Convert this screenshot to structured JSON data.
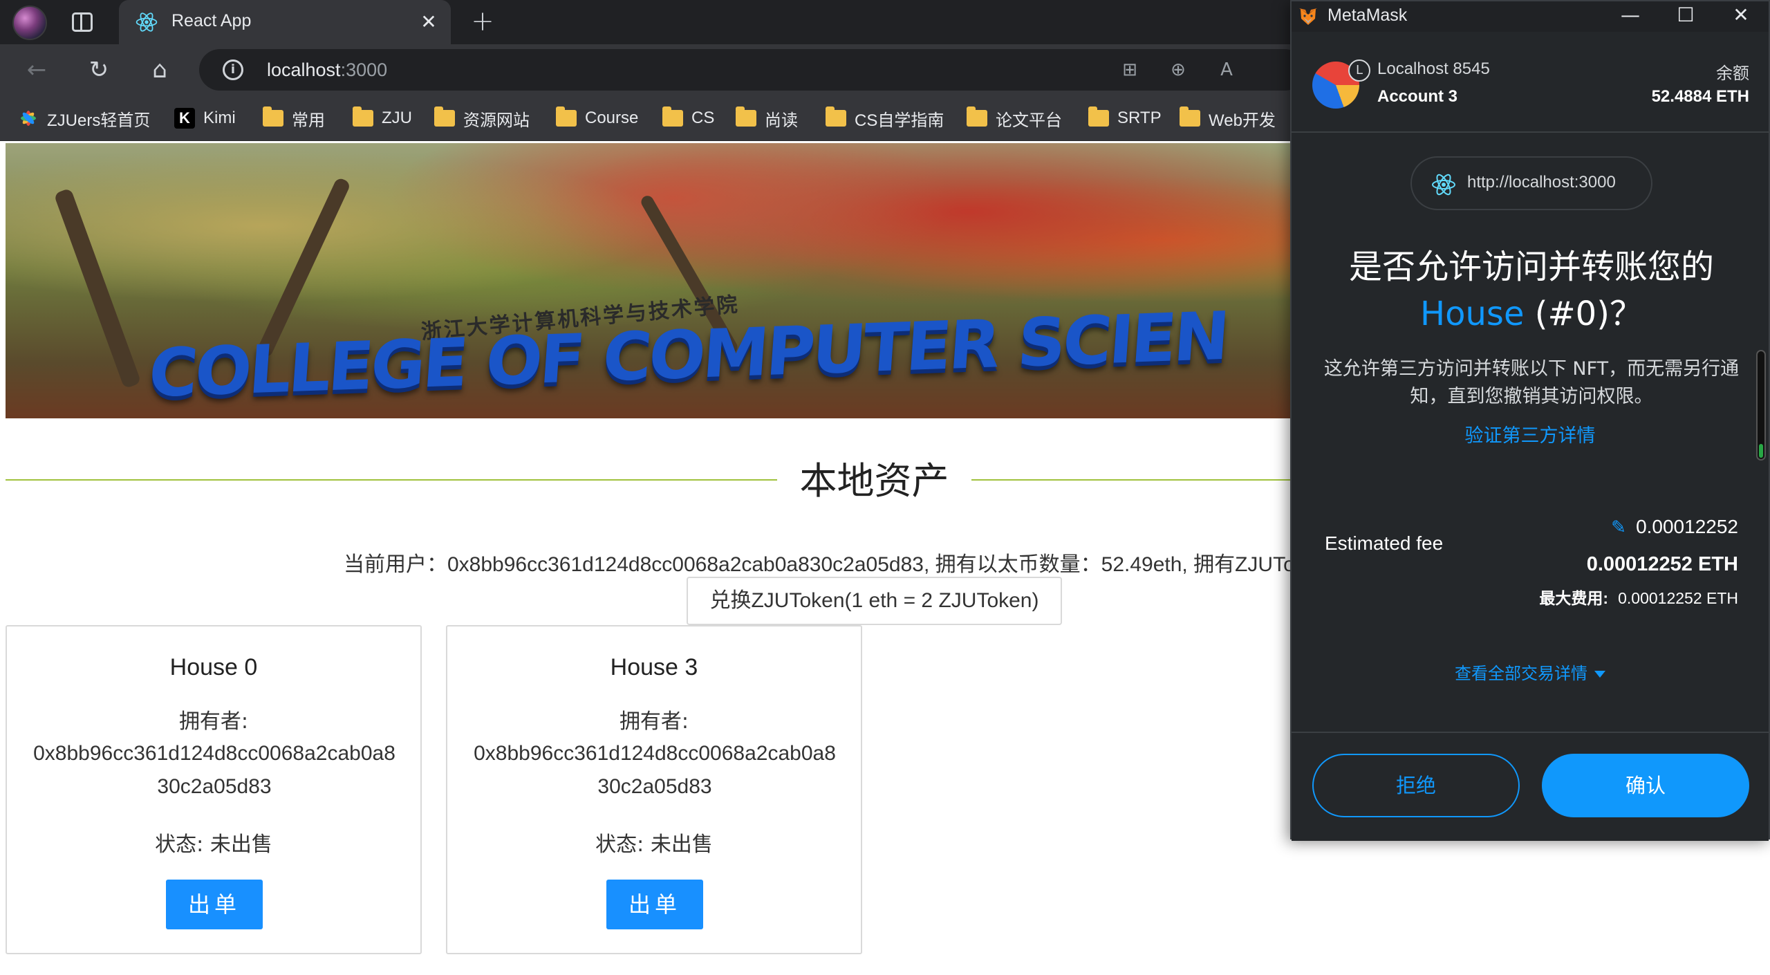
{
  "browser": {
    "tab_title": "React App",
    "url_host": "localhost",
    "url_port": ":3000",
    "bookmarks": [
      {
        "label": "ZJUers轻首页",
        "icon": "zju-flower-icon"
      },
      {
        "label": "Kimi",
        "icon": "kimi-icon"
      },
      {
        "label": "常用",
        "icon": "folder-icon"
      },
      {
        "label": "ZJU",
        "icon": "folder-icon"
      },
      {
        "label": "资源网站",
        "icon": "folder-icon"
      },
      {
        "label": "Course",
        "icon": "folder-icon"
      },
      {
        "label": "CS",
        "icon": "folder-icon"
      },
      {
        "label": "尚读",
        "icon": "folder-icon"
      },
      {
        "label": "CS自学指南",
        "icon": "folder-icon"
      },
      {
        "label": "论文平台",
        "icon": "folder-icon"
      },
      {
        "label": "SRTP",
        "icon": "folder-icon"
      },
      {
        "label": "Web开发",
        "icon": "folder-icon"
      }
    ]
  },
  "page": {
    "banner_subtitle": "浙江大学计算机科学与技术学院",
    "banner_title": "COLLEGE OF COMPUTER SCIEN",
    "section_title": "本地资产",
    "user_info": "当前用户：0x8bb96cc361d124d8cc0068a2cab0a830c2a05d83, 拥有以太币数量：52.49eth, 拥有ZJUTo",
    "exchange_button": "兑换ZJUToken(1 eth = 2 ZJUToken)",
    "houses": [
      {
        "name": "House 0",
        "owner_label": "拥有者:",
        "owner": "0x8bb96cc361d124d8cc0068a2cab0a830c2a05d83",
        "status": "状态: 未出售",
        "action": "出单"
      },
      {
        "name": "House 3",
        "owner_label": "拥有者:",
        "owner": "0x8bb96cc361d124d8cc0068a2cab0a830c2a05d83",
        "status": "状态: 未出售",
        "action": "出单"
      }
    ]
  },
  "metamask": {
    "window_title": "MetaMask",
    "network": "Localhost 8545",
    "account": "Account 3",
    "balance_label": "余额",
    "balance": "52.4884 ETH",
    "site_url": "http://localhost:3000",
    "heading_line1": "是否允许访问并转账您的",
    "heading_accent": "House",
    "heading_rest": " (#0)？",
    "description": "这允许第三方访问并转账以下 NFT，而无需另行通知，直到您撤销其访问权限。",
    "verify_link": "验证第三方详情",
    "fee_label": "Estimated fee",
    "fee_top": "0.00012252",
    "fee_main": "0.00012252 ETH",
    "fee_max_label": "最大费用:",
    "fee_max_value": "0.00012252 ETH",
    "view_details": "查看全部交易详情",
    "reject": "拒绝",
    "confirm": "确认"
  },
  "colors": {
    "accent_blue": "#1098fc",
    "antd_primary": "#1890ff",
    "divider_green": "#a0c23c",
    "metamask_bg": "#24272a"
  }
}
